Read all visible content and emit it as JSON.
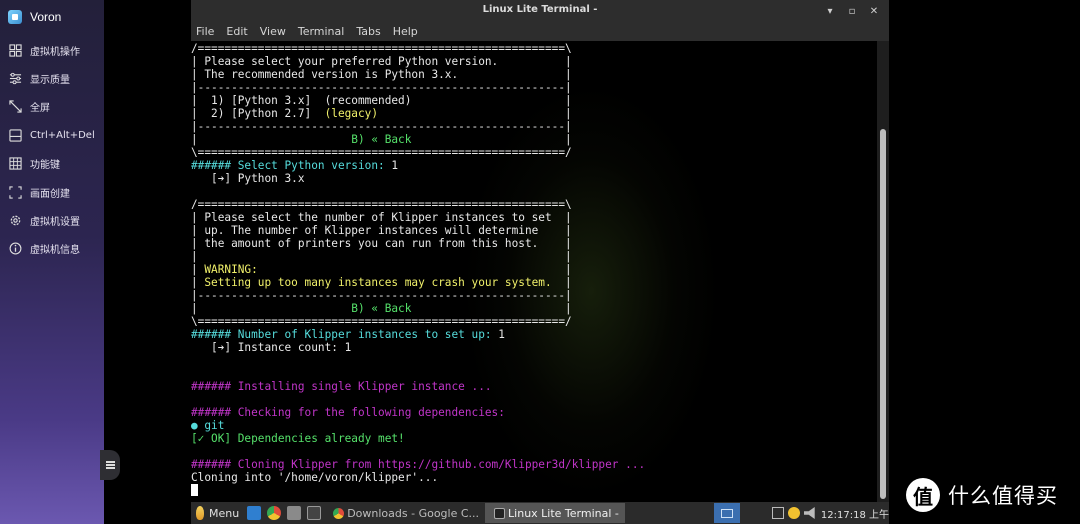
{
  "sidebar": {
    "title": "Voron",
    "items": [
      {
        "label": "虚拟机操作",
        "icon": "vm-operations-icon"
      },
      {
        "label": "显示质量",
        "icon": "display-quality-icon"
      },
      {
        "label": "全屏",
        "icon": "fullscreen-icon"
      },
      {
        "label": "Ctrl+Alt+Del",
        "icon": "ctrl-alt-del-icon"
      },
      {
        "label": "功能键",
        "icon": "function-keys-icon"
      },
      {
        "label": "画面创建",
        "icon": "screen-capture-icon"
      },
      {
        "label": "虚拟机设置",
        "icon": "vm-settings-icon"
      },
      {
        "label": "虚拟机信息",
        "icon": "vm-info-icon"
      }
    ]
  },
  "window": {
    "title": "Linux Lite Terminal -",
    "controls": {
      "minimize": "▾",
      "maximize": "▫",
      "close": "✕"
    },
    "menu": [
      "File",
      "Edit",
      "View",
      "Terminal",
      "Tabs",
      "Help"
    ]
  },
  "terminal": {
    "lines": [
      [
        {
          "t": "/=======================================================\\",
          "c": "white"
        }
      ],
      [
        {
          "t": "| Please select your preferred Python version.          |",
          "c": "white"
        }
      ],
      [
        {
          "t": "| The recommended version is Python 3.x.                |",
          "c": "white"
        }
      ],
      [
        {
          "t": "|-------------------------------------------------------|",
          "c": "white"
        }
      ],
      [
        {
          "t": "|  1) [Python 3.x]  (recommended)                       |",
          "c": "white"
        }
      ],
      [
        {
          "t": "|  2) [Python 2.7]  ",
          "c": "white"
        },
        {
          "t": "(legacy)",
          "c": "yellow"
        },
        {
          "t": "                            |",
          "c": "white"
        }
      ],
      [
        {
          "t": "|-------------------------------------------------------|",
          "c": "white"
        }
      ],
      [
        {
          "t": "|                       ",
          "c": "white"
        },
        {
          "t": "B) « Back",
          "c": "green"
        },
        {
          "t": "                       |",
          "c": "white"
        }
      ],
      [
        {
          "t": "\\=======================================================/",
          "c": "white"
        }
      ],
      [
        {
          "t": "###### Select Python version: ",
          "c": "cyan"
        },
        {
          "t": "1",
          "c": "white"
        }
      ],
      [
        {
          "t": "   [➔] Python 3.x",
          "c": "white"
        }
      ],
      [
        {
          "t": "",
          "c": "white"
        }
      ],
      [
        {
          "t": "/=======================================================\\",
          "c": "white"
        }
      ],
      [
        {
          "t": "| Please select the number of Klipper instances to set  |",
          "c": "white"
        }
      ],
      [
        {
          "t": "| up. The number of Klipper instances will determine    |",
          "c": "white"
        }
      ],
      [
        {
          "t": "| the amount of printers you can run from this host.    |",
          "c": "white"
        }
      ],
      [
        {
          "t": "|                                                       |",
          "c": "white"
        }
      ],
      [
        {
          "t": "| ",
          "c": "white"
        },
        {
          "t": "WARNING:",
          "c": "yellow"
        },
        {
          "t": "                                              |",
          "c": "white"
        }
      ],
      [
        {
          "t": "| ",
          "c": "white"
        },
        {
          "t": "Setting up too many instances may crash your system.",
          "c": "yellow"
        },
        {
          "t": "  |",
          "c": "white"
        }
      ],
      [
        {
          "t": "|-------------------------------------------------------|",
          "c": "white"
        }
      ],
      [
        {
          "t": "|                       ",
          "c": "white"
        },
        {
          "t": "B) « Back",
          "c": "green"
        },
        {
          "t": "                       |",
          "c": "white"
        }
      ],
      [
        {
          "t": "\\=======================================================/",
          "c": "white"
        }
      ],
      [
        {
          "t": "###### Number of Klipper instances to set up: ",
          "c": "cyan"
        },
        {
          "t": "1",
          "c": "white"
        }
      ],
      [
        {
          "t": "   [➔] Instance count: 1",
          "c": "white"
        }
      ],
      [
        {
          "t": "",
          "c": "white"
        }
      ],
      [
        {
          "t": "",
          "c": "white"
        }
      ],
      [
        {
          "t": "###### Installing single Klipper instance ...",
          "c": "magenta"
        }
      ],
      [
        {
          "t": "",
          "c": "white"
        }
      ],
      [
        {
          "t": "###### Checking for the following dependencies:",
          "c": "magenta"
        }
      ],
      [
        {
          "t": "● ",
          "c": "cyan"
        },
        {
          "t": "git",
          "c": "cyan"
        }
      ],
      [
        {
          "t": "[✓ OK] Dependencies already met!",
          "c": "green"
        }
      ],
      [
        {
          "t": "",
          "c": "white"
        }
      ],
      [
        {
          "t": "###### Cloning Klipper from https://github.com/Klipper3d/klipper ...",
          "c": "magenta"
        }
      ],
      [
        {
          "t": "Cloning into '/home/voron/klipper'...",
          "c": "white"
        }
      ]
    ]
  },
  "taskbar": {
    "menu_label": "Menu",
    "tasks": [
      {
        "label": "Downloads - Google C...",
        "active": false
      },
      {
        "label": "Linux Lite Terminal -",
        "active": true
      }
    ],
    "clock": "12:17:18 上午"
  },
  "watermark": {
    "badge": "值",
    "text": "什么值得买"
  }
}
